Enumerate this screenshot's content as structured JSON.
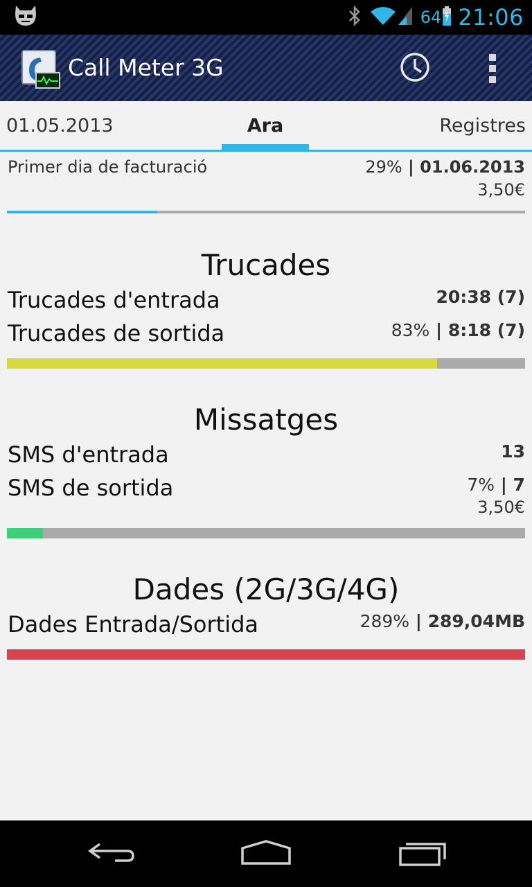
{
  "status_bar": {
    "battery_level": "64",
    "clock": "21:06",
    "icons": [
      "cyanogenmod-icon",
      "bluetooth-icon",
      "wifi-icon",
      "signal-icon",
      "battery-charging-icon"
    ]
  },
  "action_bar": {
    "title": "Call Meter 3G",
    "icons": [
      "app-icon",
      "history-icon",
      "overflow-menu-icon"
    ]
  },
  "tabs": {
    "left": "01.05.2013",
    "center": "Ara",
    "right": "Registres",
    "accent_color": "#33b5e5"
  },
  "billing": {
    "label": "Primer dia de facturació",
    "percent": "29%",
    "separator": " | ",
    "date": "01.06.2013",
    "cost": "3,50€",
    "progress_fraction": 0.29,
    "bar_color": "#33b5e5"
  },
  "calls": {
    "title": "Trucades",
    "incoming_label": "Trucades d'entrada",
    "incoming_value": "20:38 (7)",
    "outgoing_label": "Trucades de sortida",
    "outgoing_percent": "83%",
    "outgoing_separator": " | ",
    "outgoing_value": "8:18 (7)",
    "progress_fraction": 0.83,
    "bar_color": "#d9d93e"
  },
  "messages": {
    "title": "Missatges",
    "incoming_label": "SMS d'entrada",
    "incoming_value": "13",
    "outgoing_label": "SMS de sortida",
    "outgoing_percent": "7%",
    "outgoing_separator": " | ",
    "outgoing_value": "7",
    "cost": "3,50€",
    "progress_fraction": 0.07,
    "bar_color": "#3ecf78"
  },
  "data": {
    "title": "Dades (2G/3G/4G)",
    "label": "Dades Entrada/Sortida",
    "percent": "289%",
    "separator": " | ",
    "value": "289,04MB",
    "progress_fraction": 1.0,
    "bar_color": "#d8444e"
  },
  "nav_bar": {
    "icons": [
      "back-icon",
      "home-icon",
      "recent-apps-icon"
    ]
  }
}
